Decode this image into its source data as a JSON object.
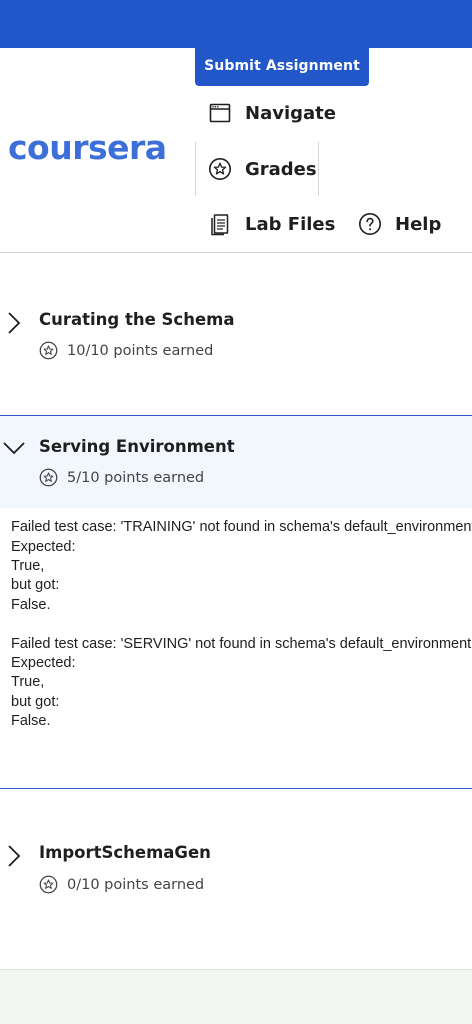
{
  "header": {
    "submit_label": "Submit Assignment",
    "logo_text": "coursera",
    "brand_color": "#2257c9"
  },
  "nav": {
    "navigate": {
      "label": "Navigate",
      "icon": "browser-window-icon"
    },
    "grades": {
      "label": "Grades",
      "icon": "star-circle-icon"
    },
    "lab_files": {
      "label": "Lab Files",
      "icon": "files-icon"
    },
    "help": {
      "label": "Help",
      "icon": "question-circle-icon"
    }
  },
  "sections": [
    {
      "title": "Curating the Schema",
      "points": "10/10 points earned",
      "expanded": false
    },
    {
      "title": "Serving Environment",
      "points": "5/10 points earned",
      "expanded": true,
      "feedback": [
        "Failed test case: 'TRAINING' not found in schema's default_environment.",
        "Expected:",
        "True,",
        "but got:",
        "False.",
        "",
        "Failed test case: 'SERVING' not found in schema's default_environment.",
        "Expected:",
        "True,",
        "but got:",
        "False."
      ]
    },
    {
      "title": "ImportSchemaGen",
      "points": "0/10 points earned",
      "expanded": false
    }
  ]
}
